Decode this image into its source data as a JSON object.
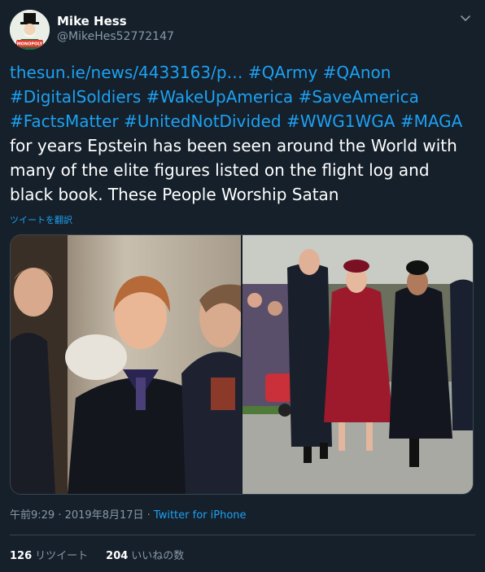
{
  "user": {
    "display_name": "Mike Hess",
    "handle": "@MikeHes52772147",
    "avatar_text": "Mr. Monopoly"
  },
  "tweet": {
    "link_text": "thesun.ie/news/4433163/p…",
    "hashtags": [
      "#QArmy",
      "#QAnon",
      "#DigitalSoldiers",
      "#WakeUpAmerica",
      "#SaveAmerica",
      "#FactsMatter",
      "#UnitedNotDivided",
      "#WWG1WGA",
      "#MAGA"
    ],
    "text": "for years Epstein has been seen around the World with many of the elite figures listed on the flight log and black book. These People Worship Satan",
    "translate_label": "ツイートを翻訳"
  },
  "meta": {
    "time": "午前9:29",
    "separator": " · ",
    "date": "2019年8月17日",
    "source": "Twitter for iPhone"
  },
  "stats": {
    "retweets_count": "126",
    "retweets_label": "リツイート",
    "likes_count": "204",
    "likes_label": "いいねの数"
  },
  "colors": {
    "background": "#15202b",
    "accent": "#1da1f2",
    "secondary_text": "#8899a6",
    "border": "#38444d"
  }
}
